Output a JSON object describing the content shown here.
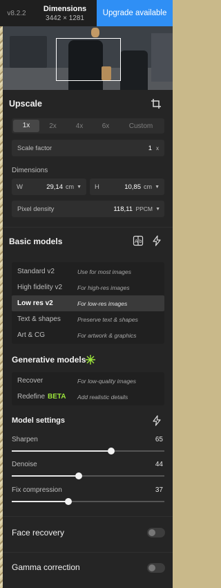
{
  "header": {
    "version": "v8.2.2",
    "dimensions_title": "Dimensions",
    "dimensions_value": "3442 × 1281",
    "upgrade_label": "Upgrade available"
  },
  "upscale": {
    "title": "Upscale",
    "scales": [
      "1x",
      "2x",
      "4x",
      "6x",
      "Custom"
    ],
    "selected_scale": "1x",
    "scale_factor_label": "Scale factor",
    "scale_factor_value": "1",
    "scale_factor_unit": "x",
    "dimensions_label": "Dimensions",
    "width_label": "W",
    "width_value": "29,14",
    "width_unit": "cm",
    "height_label": "H",
    "height_value": "10,85",
    "height_unit": "cm",
    "pixel_density_label": "Pixel density",
    "pixel_density_value": "118,11",
    "pixel_density_unit": "PPCM"
  },
  "basic_models": {
    "title": "Basic models",
    "items": [
      {
        "name": "Standard v2",
        "desc": "Use for most images"
      },
      {
        "name": "High fidelity v2",
        "desc": "For high-res images"
      },
      {
        "name": "Low res v2",
        "desc": "For low-res images"
      },
      {
        "name": "Text & shapes",
        "desc": "Preserve text & shapes"
      },
      {
        "name": "Art & CG",
        "desc": "For artwork & graphics"
      }
    ],
    "selected": "Low res v2"
  },
  "generative_models": {
    "title": "Generative models",
    "items": [
      {
        "name": "Recover",
        "desc": "For low-quality images",
        "badge": ""
      },
      {
        "name": "Redefine",
        "desc": "Add realistic details",
        "badge": "BETA"
      }
    ]
  },
  "model_settings": {
    "title": "Model settings",
    "sliders": [
      {
        "label": "Sharpen",
        "value": 65
      },
      {
        "label": "Denoise",
        "value": 44
      },
      {
        "label": "Fix compression",
        "value": 37
      }
    ]
  },
  "face_recovery": {
    "label": "Face recovery",
    "enabled": false
  },
  "gamma_correction": {
    "label": "Gamma correction",
    "enabled": false
  },
  "colors": {
    "accent": "#2f8ff5",
    "beta": "#9be33b"
  }
}
